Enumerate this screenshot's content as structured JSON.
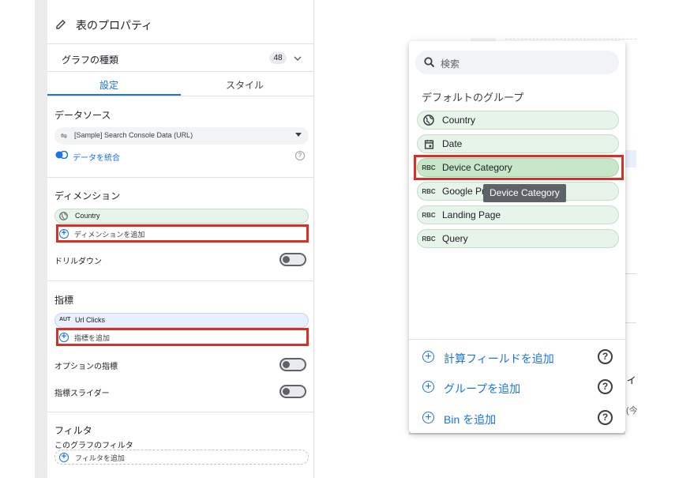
{
  "panel": {
    "title": "表のプロパティ",
    "chart_type_label": "グラフの種類",
    "chart_type_badge": "48",
    "tabs": [
      "設定",
      "スタイル"
    ],
    "datasource": {
      "heading": "データソース",
      "source_name": "[Sample] Search Console Data (URL)",
      "blend_link": "データを統合"
    },
    "dimension": {
      "heading": "ディメンション",
      "field": "Country",
      "add": "ディメンションを追加",
      "drilldown": "ドリルダウン"
    },
    "metric": {
      "heading": "指標",
      "field_type": "AUT",
      "field": "Url Clicks",
      "add": "指標を追加",
      "optional": "オプションの指標",
      "slider": "指標スライダー"
    },
    "filter": {
      "heading": "フィルタ",
      "sub": "このグラフのフィルタ",
      "add": "フィルタを追加"
    }
  },
  "popup": {
    "search_placeholder": "検索",
    "group_heading": "デフォルトのグループ",
    "fields": [
      {
        "type": "globe",
        "label": "Country"
      },
      {
        "type": "date",
        "label": "Date"
      },
      {
        "type": "RBC",
        "label": "Device Category"
      },
      {
        "type": "RBC",
        "label": "Google Pr"
      },
      {
        "type": "RBC",
        "label": "Landing Page"
      },
      {
        "type": "RBC",
        "label": "Query"
      }
    ],
    "tooltip": "Device Category",
    "actions": [
      "計算フィールドを追加",
      "グループを追加",
      "Bin を追加"
    ]
  },
  "colors": {
    "accent": "#1a73e8",
    "highlight_red": "#d93025",
    "field_green": "#e6f4ea",
    "metric_blue": "#e8f0fe"
  },
  "background_fragments": [
    "ィ",
    "(今"
  ]
}
